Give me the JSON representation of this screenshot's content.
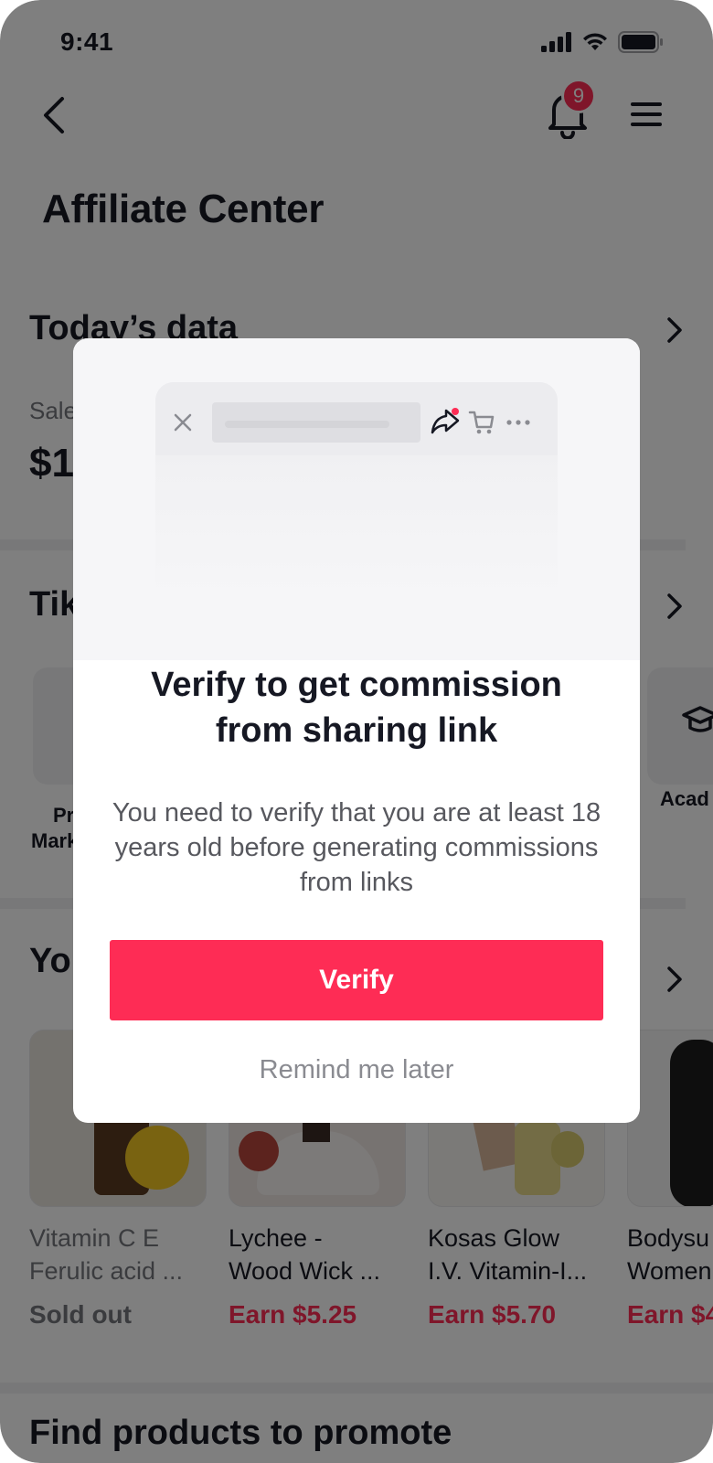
{
  "status": {
    "time": "9:41"
  },
  "header": {
    "notifications_count": "9"
  },
  "page": {
    "title": "Affiliate Center"
  },
  "today": {
    "section_title": "Today’s data",
    "label": "Sale",
    "value": "$1"
  },
  "tools": {
    "section_title": "Tik",
    "items": [
      {
        "label_line1": "Pr",
        "label_line2": "Mark"
      },
      {
        "label_line1": "Acad",
        "label_line2": ""
      }
    ]
  },
  "products": {
    "section_title": "Yo",
    "items": [
      {
        "name_line1": "Vitamin C E",
        "name_line2": "Ferulic acid ...",
        "status": "Sold out",
        "sold_out": true
      },
      {
        "name_line1": "Lychee -",
        "name_line2": "Wood Wick ...",
        "status": "Earn $5.25",
        "sold_out": false
      },
      {
        "name_line1": "Kosas Glow",
        "name_line2": "I.V. Vitamin-I...",
        "status": "Earn $5.70",
        "sold_out": false
      },
      {
        "name_line1": "Bodysu",
        "name_line2": "Women",
        "status": "Earn $4",
        "sold_out": false
      }
    ]
  },
  "find": {
    "section_title": "Find products to promote"
  },
  "modal": {
    "title_line1": "Verify to get commission",
    "title_line2": "from sharing link",
    "body": "You need to verify that you are at least 18 years old before generating commissions from links",
    "primary_label": "Verify",
    "secondary_label": "Remind me later"
  },
  "colors": {
    "accent": "#fe2c55",
    "text": "#161823",
    "muted": "#75777d",
    "scrim": "rgba(0,0,0,0.5)"
  }
}
